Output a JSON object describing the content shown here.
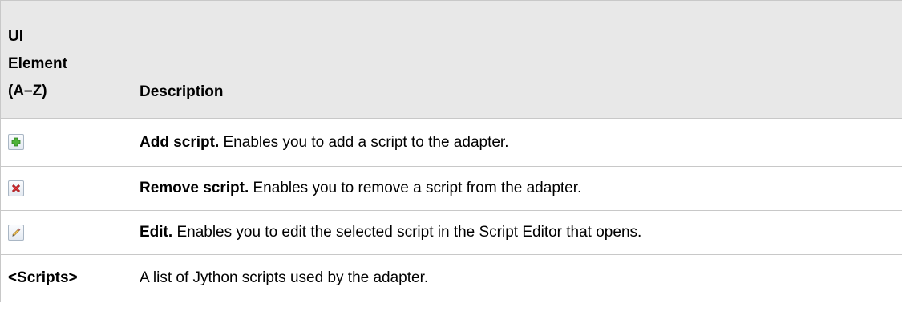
{
  "table": {
    "headers": {
      "element_line1": "UI",
      "element_line2": "Element",
      "element_line3": "(A–Z)",
      "description": "Description"
    },
    "rows": [
      {
        "icon": "add-icon",
        "lead": "Add script.",
        "text": " Enables you to add a script to the adapter."
      },
      {
        "icon": "remove-icon",
        "lead": "Remove script.",
        "text": " Enables you to remove a script from the adapter."
      },
      {
        "icon": "edit-pencil-icon",
        "lead": "Edit.",
        "text": " Enables you to edit the selected script in the Script Editor that opens."
      },
      {
        "element": "<Scripts>",
        "text": "A list of Jython scripts used by the adapter."
      }
    ]
  },
  "colors": {
    "header_bg": "#e8e8e8",
    "border": "#c8c8c8",
    "add_icon": "#3a9a2a",
    "remove_icon": "#d4262b"
  }
}
